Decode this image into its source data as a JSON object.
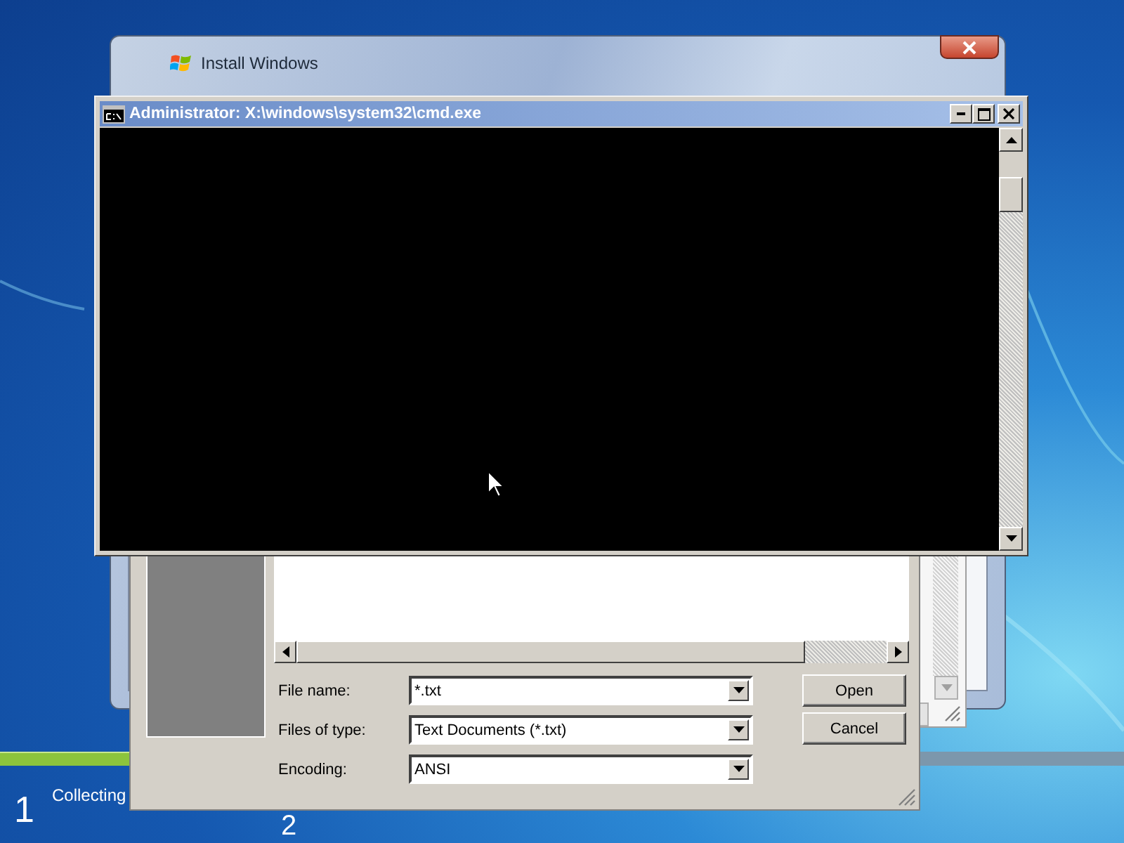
{
  "install_window": {
    "title": "Install Windows"
  },
  "progress": {
    "level": 0.12
  },
  "steps": [
    {
      "number": "1",
      "label": "Collecting"
    },
    {
      "number": "2"
    }
  ],
  "open_dialog": {
    "fields": [
      {
        "label": "File name:",
        "value": "*.txt"
      },
      {
        "label": "Files of type:",
        "value": "Text Documents (*.txt)"
      },
      {
        "label": "Encoding:",
        "value": "ANSI"
      }
    ],
    "buttons": [
      "Open",
      "Cancel"
    ]
  },
  "cmd_window": {
    "title": "Administrator: X:\\windows\\system32\\cmd.exe"
  }
}
